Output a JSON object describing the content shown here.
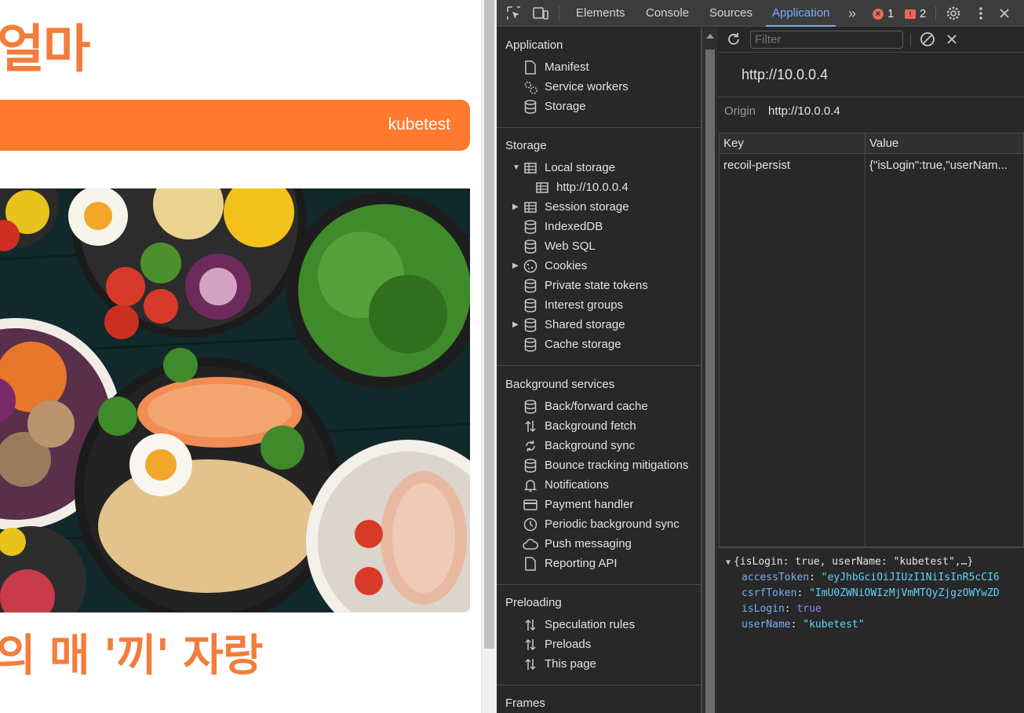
{
  "webpage": {
    "title": "얼마",
    "user_name": "kubetest",
    "subtitle": "의 매 '끼' 자랑",
    "hero_image_name": "food-bowls-photo"
  },
  "devtools": {
    "tabs": [
      "Elements",
      "Console",
      "Sources",
      "Application"
    ],
    "active_tab": "Application",
    "error_count": "1",
    "warning_count": "2",
    "sidebar": {
      "application": {
        "heading": "Application",
        "items": [
          "Manifest",
          "Service workers",
          "Storage"
        ]
      },
      "storage": {
        "heading": "Storage",
        "local_storage": "Local storage",
        "local_storage_origin": "http://10.0.0.4",
        "items": [
          "Session storage",
          "IndexedDB",
          "Web SQL",
          "Cookies",
          "Private state tokens",
          "Interest groups",
          "Shared storage",
          "Cache storage"
        ]
      },
      "background": {
        "heading": "Background services",
        "items": [
          "Back/forward cache",
          "Background fetch",
          "Background sync",
          "Bounce tracking mitigations",
          "Notifications",
          "Payment handler",
          "Periodic background sync",
          "Push messaging",
          "Reporting API"
        ]
      },
      "preloading": {
        "heading": "Preloading",
        "items": [
          "Speculation rules",
          "Preloads",
          "This page"
        ]
      },
      "frames": {
        "heading": "Frames"
      }
    },
    "filter_placeholder": "Filter",
    "origin_title": "http://10.0.0.4",
    "origin_label": "Origin",
    "origin_value": "http://10.0.0.4",
    "table": {
      "headers": [
        "Key",
        "Value"
      ],
      "rows": [
        {
          "key": "recoil-persist",
          "value": "{\"isLogin\":true,\"userNam..."
        }
      ]
    },
    "preview": {
      "summary": "{isLogin: true, userName: \"kubetest\",…}",
      "fields": [
        {
          "key": "accessToken",
          "value": "\"eyJhbGciOiJIUzI1NiIsInR5cCI6",
          "type": "string"
        },
        {
          "key": "csrfToken",
          "value": "\"ImU0ZWNiOWIzMjVmMTQyZjgzOWYwZD",
          "type": "string"
        },
        {
          "key": "isLogin",
          "value": "true",
          "type": "boolean"
        },
        {
          "key": "userName",
          "value": "\"kubetest\"",
          "type": "string"
        }
      ]
    }
  }
}
